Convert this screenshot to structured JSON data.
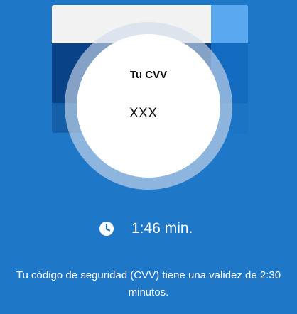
{
  "cvv": {
    "title": "Tu CVV",
    "value": "XXX"
  },
  "timer": {
    "icon": "clock-icon",
    "remaining": "1:46 min."
  },
  "message": "Tu código de seguridad (CVV) tiene una validez de 2:30 minutos.",
  "colors": {
    "background": "#1f77c8",
    "card_top": "#f2f2f2",
    "card_accent": "#5aa9f0",
    "card_band": "#0a4287",
    "disc": "#ffffff"
  }
}
